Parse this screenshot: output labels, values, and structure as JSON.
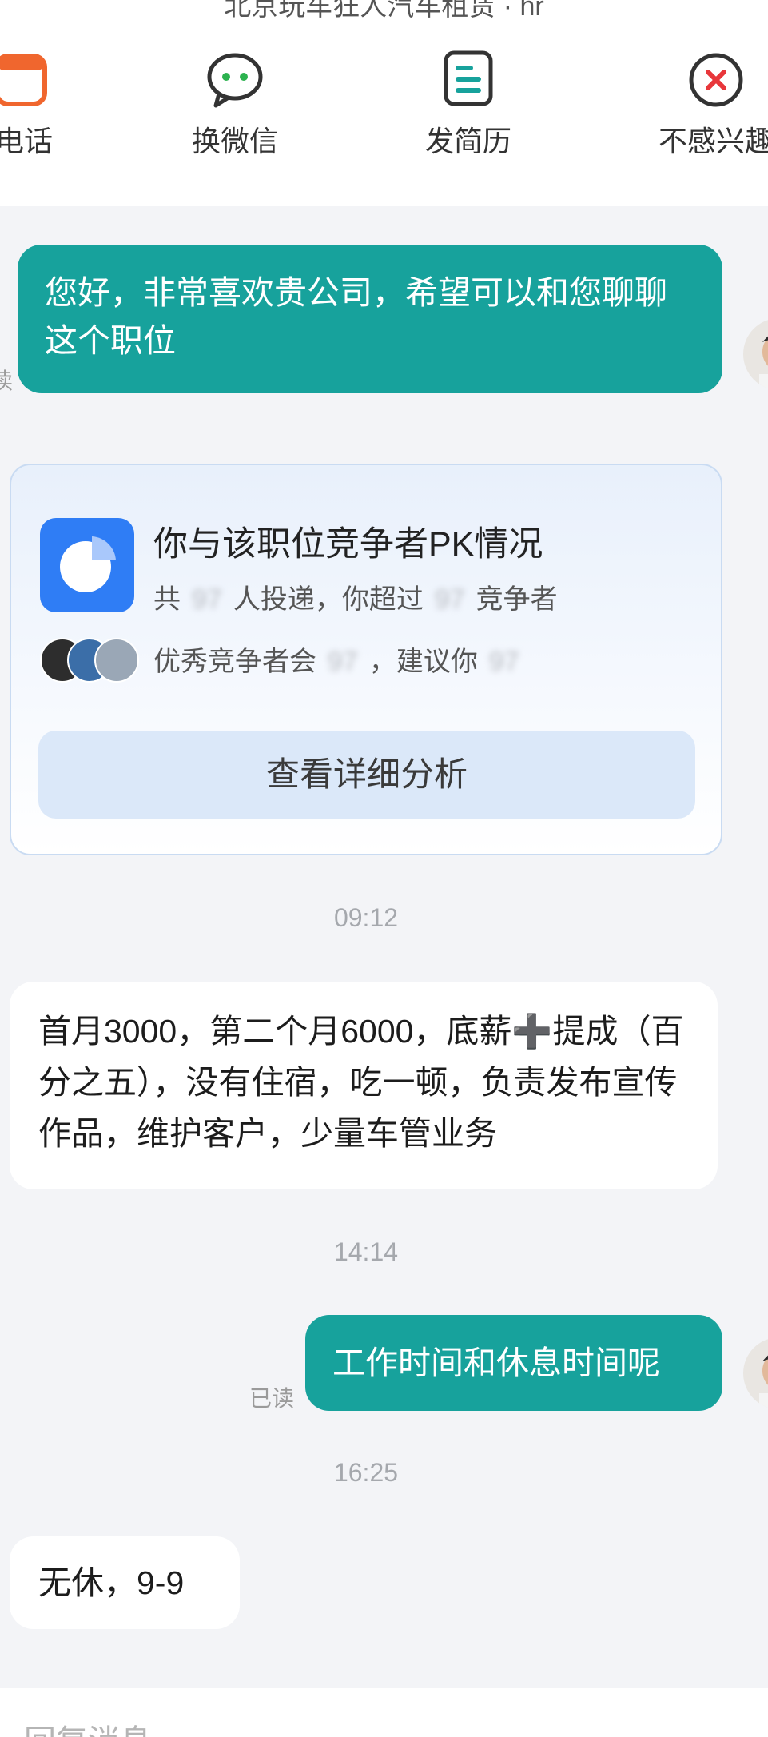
{
  "header": {
    "title": "北京玩车狂人汽车租赁 · hr"
  },
  "actions": [
    {
      "label": "电话",
      "icon": "phone-icon"
    },
    {
      "label": "换微信",
      "icon": "wechat-icon"
    },
    {
      "label": "发简历",
      "icon": "resume-icon"
    },
    {
      "label": "不感兴趣",
      "icon": "close-circle-icon"
    }
  ],
  "messages": {
    "m1": "您好，非常喜欢贵公司，希望可以和您聊聊这个职位",
    "m1_read": "读",
    "card": {
      "title": "你与该职位竞争者PK情况",
      "line1_a": "共",
      "line1_blur1": "97",
      "line1_b": "人投递，你超过",
      "line1_blur2": "97",
      "line1_c": "竞争者",
      "line2_a": "优秀竞争者会",
      "line2_blur1": "97",
      "line2_b": "，建议你",
      "line2_blur2": "97",
      "button": "查看详细分析"
    },
    "t1": "09:12",
    "m2": "首月3000，第二个月6000，底薪➕提成（百分之五），没有住宿，吃一顿，负责发布宣传作品，维护客户，少量车管业务",
    "t2": "14:14",
    "m3": "工作时间和休息时间呢",
    "m3_read": "已读",
    "t3": "16:25",
    "m4": "无休，9-9"
  },
  "input": {
    "placeholder": "回复消息"
  },
  "colors": {
    "outgoing_bubble": "#17a29c",
    "card_icon": "#2f7df5",
    "accent_green": "#2cb24f",
    "accent_red": "#e8373b"
  }
}
